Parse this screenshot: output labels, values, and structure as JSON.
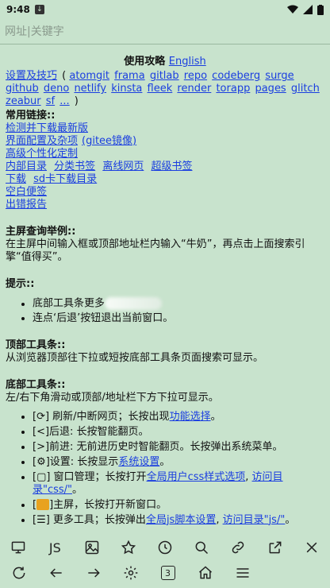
{
  "status": {
    "time": "9:48"
  },
  "address": {
    "placeholder": "网址|关键字"
  },
  "guide": {
    "title": "使用攻略",
    "english": "English"
  },
  "links1": [
    "设置及技巧",
    "atomgit",
    "frama",
    "gitlab",
    "repo",
    "codeberg",
    "surge",
    "github",
    "deno",
    "netlify",
    "kinsta",
    "fleek",
    "render",
    "torapp",
    "pages",
    "glitch",
    "zeabur",
    "sf",
    "..."
  ],
  "common": {
    "heading": "常用链接::",
    "check": "检测并下载最新版",
    "ui": "界面配置及杂项",
    "gitee": "(gitee镜像)",
    "advanced": "高级个性化定制",
    "internal": "内部目录",
    "category": "分类书签",
    "offline": "离线网页",
    "super": "超级书签",
    "download": "下载",
    "sdcard": "sd卡下载目录",
    "blank": "空白便签",
    "error": "出错报告"
  },
  "homepage": {
    "heading": "主屏查询举例::",
    "text": "在主屏中间输入框或顶部地址栏内输入“牛奶”，再点击上面搜索引擎“值得买”。"
  },
  "tips": {
    "heading": "提示::",
    "item1": "底部工具条更多",
    "item2": "连点‘后退’按钮退出当前窗口。"
  },
  "top_toolbar": {
    "heading": "顶部工具条::",
    "text": "从浏览器顶部往下拉或短按底部工具条页面搜索可显示。"
  },
  "bottom_toolbar": {
    "heading": "底部工具条::",
    "text": "左/右下角滑动或顶部/地址栏下方下拉可显示。",
    "k1": "[⟳] 刷新/中断网页；长按出现",
    "k1_link": "功能选择",
    "k2": "[<]后退: 长按智能翻页。",
    "k3": "[>]前进: 无前进历史时智能翻页。长按弹出系统菜单。",
    "k4": "[⚙]设置: 长按显示",
    "k4_link": "系统设置",
    "k5": "[▢] 窗口管理；长按打开",
    "k5_link1": "全局用户css样式选项",
    "k5_link2": "访问目录\"css/\"",
    "k6": "主屏，长按打开新窗口。",
    "k7": "[☰] 更多工具；长按弹出",
    "k7_link1": "全局js脚本设置",
    "k7_link2": "访问目录\"js/\""
  },
  "toolbar1": {
    "js_label": "JS"
  },
  "toolbar2": {
    "tab_count": "3"
  }
}
